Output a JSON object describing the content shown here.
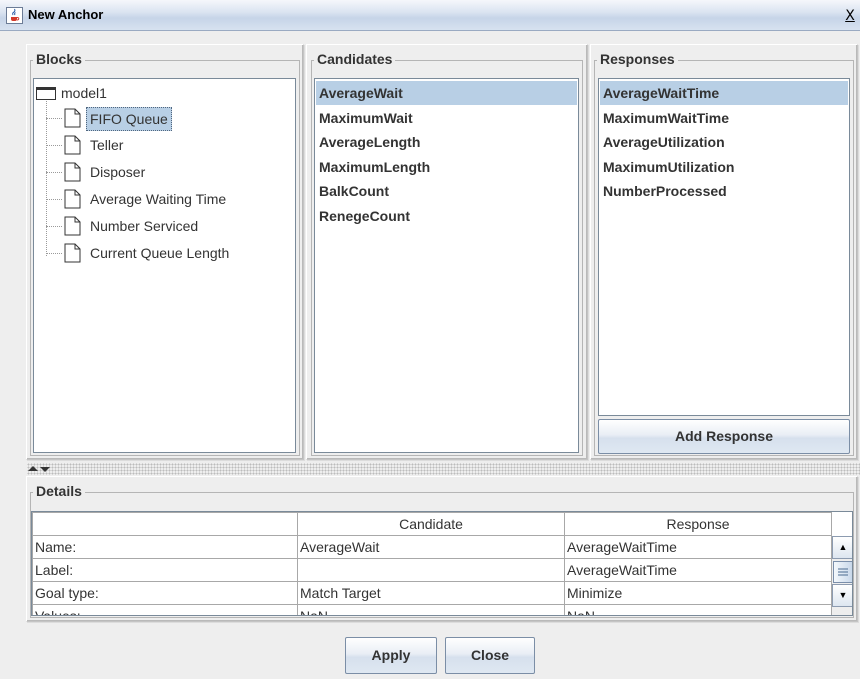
{
  "window": {
    "title": "New Anchor",
    "close_glyph": "X",
    "icon": "java-cup-icon"
  },
  "blocks": {
    "title": "Blocks",
    "root": "model1",
    "children": [
      "FIFO Queue",
      "Teller",
      "Disposer",
      "Average Waiting Time",
      "Number Serviced",
      "Current Queue Length"
    ],
    "selected": "FIFO Queue"
  },
  "candidates": {
    "title": "Candidates",
    "items": [
      "AverageWait",
      "MaximumWait",
      "AverageLength",
      "MaximumLength",
      "BalkCount",
      "RenegeCount"
    ],
    "selected": "AverageWait"
  },
  "responses": {
    "title": "Responses",
    "items": [
      "AverageWaitTime",
      "MaximumWaitTime",
      "AverageUtilization",
      "MaximumUtilization",
      "NumberProcessed"
    ],
    "selected": "AverageWaitTime",
    "add_button": "Add Response"
  },
  "details": {
    "title": "Details",
    "columns": [
      "",
      "Candidate",
      "Response"
    ],
    "rows": [
      [
        "Name:",
        "AverageWait",
        "AverageWaitTime"
      ],
      [
        "Label:",
        "",
        "AverageWaitTime"
      ],
      [
        "Goal type:",
        "Match Target",
        "Minimize"
      ],
      [
        "Values:",
        "NaN",
        "NaN"
      ]
    ]
  },
  "footer": {
    "apply_label": "Apply",
    "close_label": "Close"
  },
  "colors": {
    "selection": "#b8cfe5",
    "background": "#eeeeee",
    "titlebar": "#c6d4e8"
  }
}
